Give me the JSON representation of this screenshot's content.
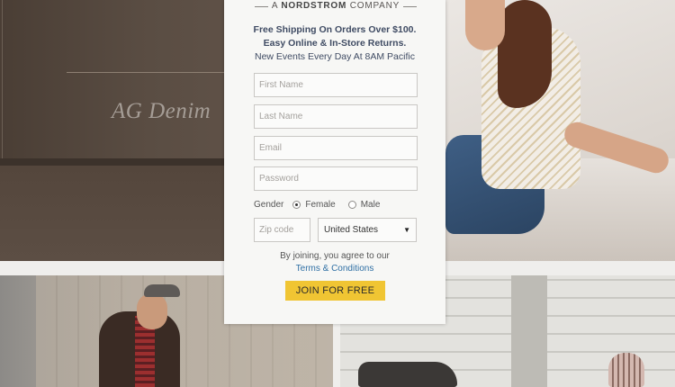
{
  "hero": {
    "brand_title": "AG Denim"
  },
  "modal": {
    "tagline_prefix": "A ",
    "tagline_brand": "NORDSTROM",
    "tagline_suffix": " COMPANY",
    "promo_line1": "Free Shipping On Orders Over $100.",
    "promo_line2": "Easy Online & In-Store Returns.",
    "promo_line3": "New Events Every Day At 8AM Pacific",
    "fields": {
      "first_name_placeholder": "First Name",
      "last_name_placeholder": "Last Name",
      "email_placeholder": "Email",
      "password_placeholder": "Password",
      "zip_placeholder": "Zip code"
    },
    "gender": {
      "label": "Gender",
      "female": "Female",
      "male": "Male",
      "selected": "Female"
    },
    "country": {
      "selected": "United States",
      "caret_icon": "chevron-down-icon"
    },
    "terms_note": "By joining, you agree to our",
    "terms_link": "Terms & Conditions",
    "join_button": "JOIN FOR FREE",
    "colors": {
      "join_button": "#f0c533",
      "link": "#2f6fa4",
      "promo_text": "#3f4b63"
    }
  }
}
